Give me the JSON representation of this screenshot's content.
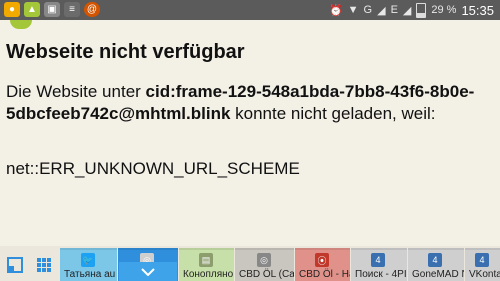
{
  "status_bar": {
    "battery_percent": "29 %",
    "battery_level": 0.29,
    "time": "15:35",
    "network_label": "G",
    "left_icons": [
      "chrome-icon",
      "android-icon",
      "image-icon",
      "reader-icon",
      "email-icon"
    ],
    "right_icons": [
      "alarm-icon",
      "wifi-icon",
      "signal-icon",
      "e-icon",
      "signal-icon"
    ]
  },
  "page": {
    "title": "Webseite nicht verfügbar",
    "message_prefix": "Die Website unter ",
    "message_url": "cid:frame-129-548a1bda-7bb8-43f6-8b0e-5dbcfeeb742c@mhtml.blink",
    "message_suffix": " konnte nicht geladen, weil:",
    "error_code": "net::ERR_UNKNOWN_URL_SCHEME"
  },
  "taskbar": {
    "tabs": [
      {
        "label": "Татьяна au",
        "bg": "#7cc7e8",
        "icon_color": "#1da1f2",
        "icon": "bird-icon"
      },
      {
        "label": "",
        "bg": "#2f8fdc",
        "icon_color": "#cfcfcf",
        "icon": "chevron-down-icon"
      },
      {
        "label": "Коноплянo",
        "bg": "#c7dfa8",
        "icon_color": "#8c9d6e",
        "icon": "page-icon"
      },
      {
        "label": "CBD ÖL (Ca",
        "bg": "#c8c6be",
        "icon_color": "#888888",
        "icon": "globe-icon"
      },
      {
        "label": "CBD Öl - Hä",
        "bg": "#e0928a",
        "icon_color": "#c0392b",
        "icon": "pin-icon"
      },
      {
        "label": "Поиск - 4PI",
        "bg": "#cfcfcf",
        "icon_color": "#3a6fb0",
        "icon": "four-icon"
      },
      {
        "label": "GoneMAD N",
        "bg": "#cfcfcf",
        "icon_color": "#3a6fb0",
        "icon": "four-icon"
      },
      {
        "label": "VKontakte",
        "bg": "#cfcfcf",
        "icon_color": "#3a6fb0",
        "icon": "four-icon"
      }
    ]
  }
}
